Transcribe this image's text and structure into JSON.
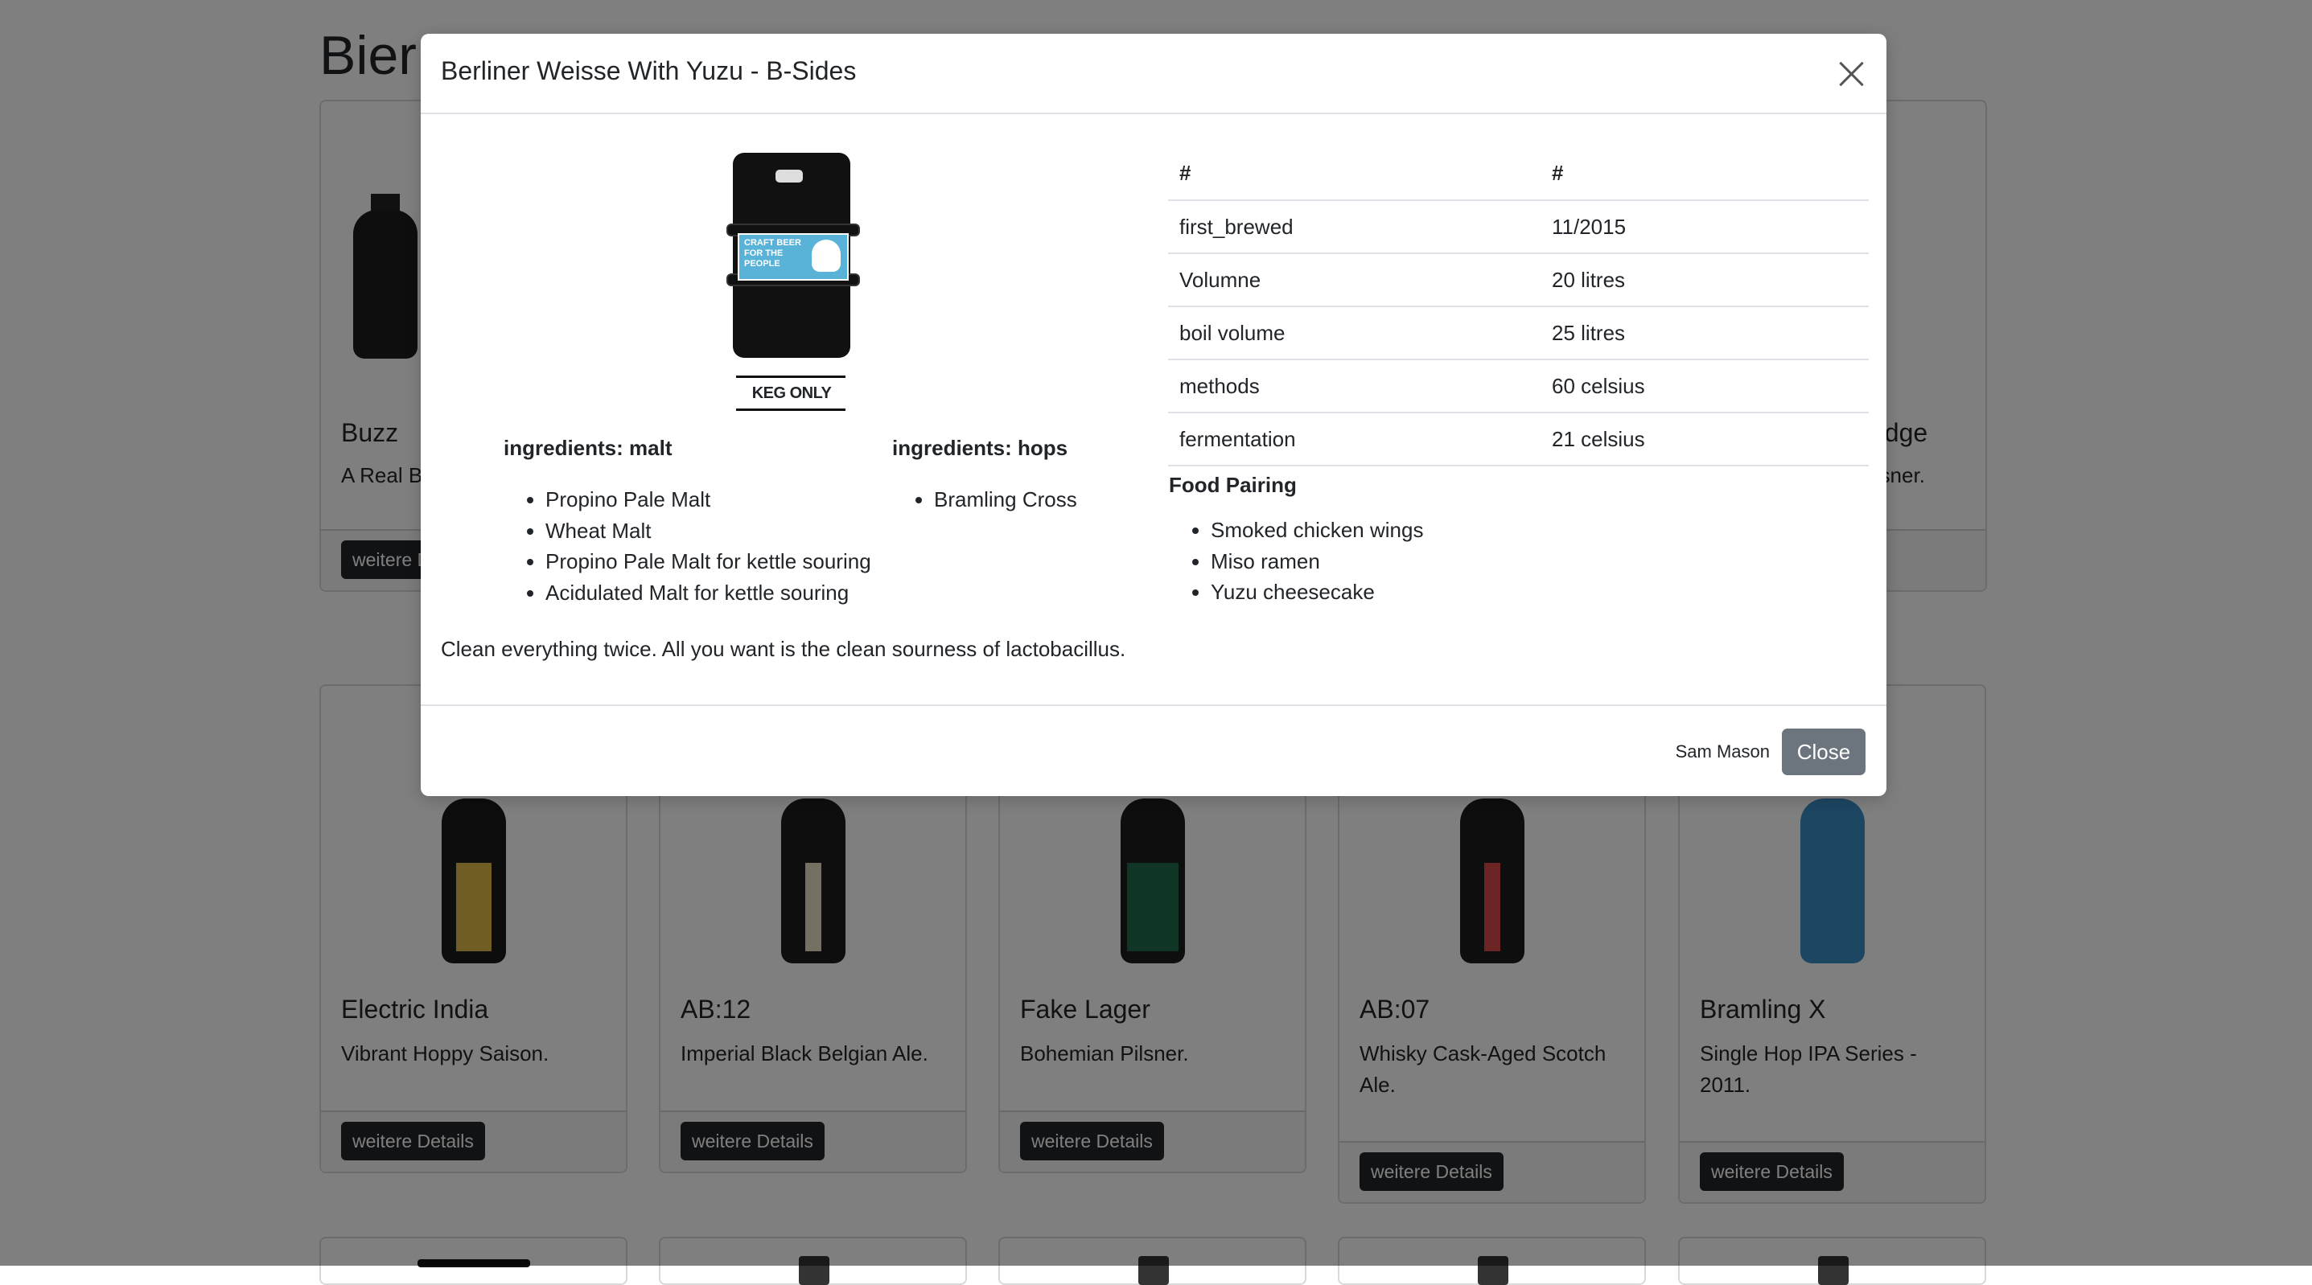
{
  "page": {
    "title": "Bier"
  },
  "cards_row1": [
    {
      "name": "Buzz",
      "tagline": "A Real Bi",
      "button": "weitere D"
    },
    {
      "name": "edge",
      "tagline": "ilsner."
    }
  ],
  "cards_row2": [
    {
      "name": "Electric India",
      "tagline": "Vibrant Hoppy Saison.",
      "button": "weitere Details"
    },
    {
      "name": "AB:12",
      "tagline": "Imperial Black Belgian Ale.",
      "button": "weitere Details"
    },
    {
      "name": "Fake Lager",
      "tagline": "Bohemian Pilsner.",
      "button": "weitere Details"
    },
    {
      "name": "AB:07",
      "tagline": "Whisky Cask-Aged Scotch Ale.",
      "button": "weitere Details"
    },
    {
      "name": "Bramling X",
      "tagline": "Single Hop IPA Series - 2011.",
      "button": "weitere Details"
    }
  ],
  "modal": {
    "title": "Berliner Weisse With Yuzu - B-Sides",
    "keg_sticker": "CRAFT BEER FOR THE PEOPLE",
    "keg_text": "KEG ONLY",
    "malt_heading": "ingredients: malt",
    "malts": [
      "Propino Pale Malt",
      "Wheat Malt",
      "Propino Pale Malt for kettle souring",
      "Acidulated Malt for kettle souring"
    ],
    "hops_heading": "ingredients: hops",
    "hops": [
      "Bramling Cross"
    ],
    "description": "Clean everything twice. All you want is the clean sourness of lactobacillus.",
    "table_headers": [
      "#",
      "#"
    ],
    "table_rows": [
      [
        "first_brewed",
        "11/2015"
      ],
      [
        "Volumne",
        "20 litres"
      ],
      [
        "boil volume",
        "25 litres"
      ],
      [
        "methods",
        "60 celsius"
      ],
      [
        "fermentation",
        "21 celsius"
      ]
    ],
    "food_heading": "Food Pairing",
    "food": [
      "Smoked chicken wings",
      "Miso ramen",
      "Yuzu cheesecake"
    ],
    "author": "Sam Mason",
    "close_label": "Close"
  },
  "colors": {
    "button_dark": "#212529",
    "close_button": "#6c757d",
    "backdrop": "rgba(0,0,0,0.5)"
  }
}
